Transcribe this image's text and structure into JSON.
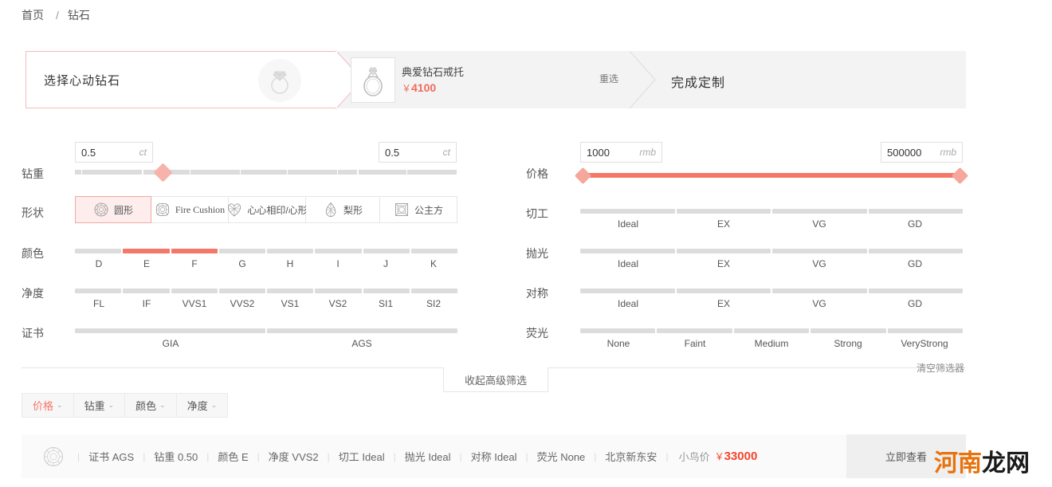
{
  "breadcrumb": {
    "home": "首页",
    "separator": "/",
    "current": "钻石"
  },
  "steps": {
    "step1": {
      "label": "选择心动钻石",
      "icon": "ring-diamond-icon"
    },
    "step2": {
      "name": "典爱钻石戒托",
      "currency": "￥",
      "price": "4100",
      "reselect": "重选",
      "icon": "ring-thumbnail-icon"
    },
    "step3": {
      "label": "完成定制"
    }
  },
  "filters": {
    "carat": {
      "label": "钻重",
      "min_value": "0.5",
      "max_value": "0.5",
      "unit": "ct",
      "handle_percent": 23
    },
    "shape": {
      "label": "形状",
      "options": [
        {
          "name": "圆形",
          "icon": "round-diamond-icon",
          "selected": true,
          "latin": false
        },
        {
          "name": "Fire Cushion",
          "icon": "cushion-diamond-icon",
          "selected": false,
          "latin": true
        },
        {
          "name": "心心相印/心形",
          "icon": "heart-diamond-icon",
          "selected": false,
          "latin": false
        },
        {
          "name": "梨形",
          "icon": "pear-diamond-icon",
          "selected": false,
          "latin": false
        },
        {
          "name": "公主方",
          "icon": "princess-diamond-icon",
          "selected": false,
          "latin": false
        }
      ]
    },
    "color": {
      "label": "颜色",
      "options": [
        "D",
        "E",
        "F",
        "G",
        "H",
        "I",
        "J",
        "K"
      ],
      "selected": [
        "E",
        "F"
      ]
    },
    "clarity": {
      "label": "净度",
      "options": [
        "FL",
        "IF",
        "VVS1",
        "VVS2",
        "VS1",
        "VS2",
        "SI1",
        "SI2"
      ],
      "selected": []
    },
    "certificate": {
      "label": "证书",
      "options": [
        "GIA",
        "AGS"
      ],
      "selected": []
    },
    "price": {
      "label": "价格",
      "min_value": "1000",
      "max_value": "500000",
      "unit": "rmb",
      "range_percent": [
        0,
        100
      ]
    },
    "cut": {
      "label": "切工",
      "options": [
        "Ideal",
        "EX",
        "VG",
        "GD"
      ],
      "selected": []
    },
    "polish": {
      "label": "抛光",
      "options": [
        "Ideal",
        "EX",
        "VG",
        "GD"
      ],
      "selected": []
    },
    "symmetry": {
      "label": "对称",
      "options": [
        "Ideal",
        "EX",
        "VG",
        "GD"
      ],
      "selected": []
    },
    "fluorescence": {
      "label": "荧光",
      "options": [
        "None",
        "Faint",
        "Medium",
        "Strong",
        "VeryStrong"
      ],
      "selected": []
    }
  },
  "controls": {
    "collapse_advanced": "收起高级筛选",
    "clear_filters": "清空筛选器",
    "chips": [
      {
        "label": "价格",
        "active": true
      },
      {
        "label": "钻重",
        "active": false
      },
      {
        "label": "颜色",
        "active": false
      },
      {
        "label": "净度",
        "active": false
      }
    ],
    "caret": "⌄"
  },
  "result": {
    "icon": "round-diamond-icon",
    "separator": "|",
    "attributes": [
      "证书 AGS",
      "钻重 0.50",
      "颜色 E",
      "净度 VVS2",
      "切工 Ideal",
      "抛光 Ideal",
      "对称 Ideal",
      "荧光 None",
      "北京新东安"
    ],
    "price_label": "小鸟价",
    "currency": "￥",
    "price": "33000",
    "view_button": "立即查看"
  },
  "watermark": {
    "part_a": "河南",
    "part_b": "龙网"
  },
  "colors": {
    "accent": "#f4786a",
    "accent_light": "#f6b3ab",
    "price_red": "#f4452e",
    "border": "#e6e6e6",
    "track": "#dcdcdc",
    "watermark_orange": "#e8720c"
  }
}
